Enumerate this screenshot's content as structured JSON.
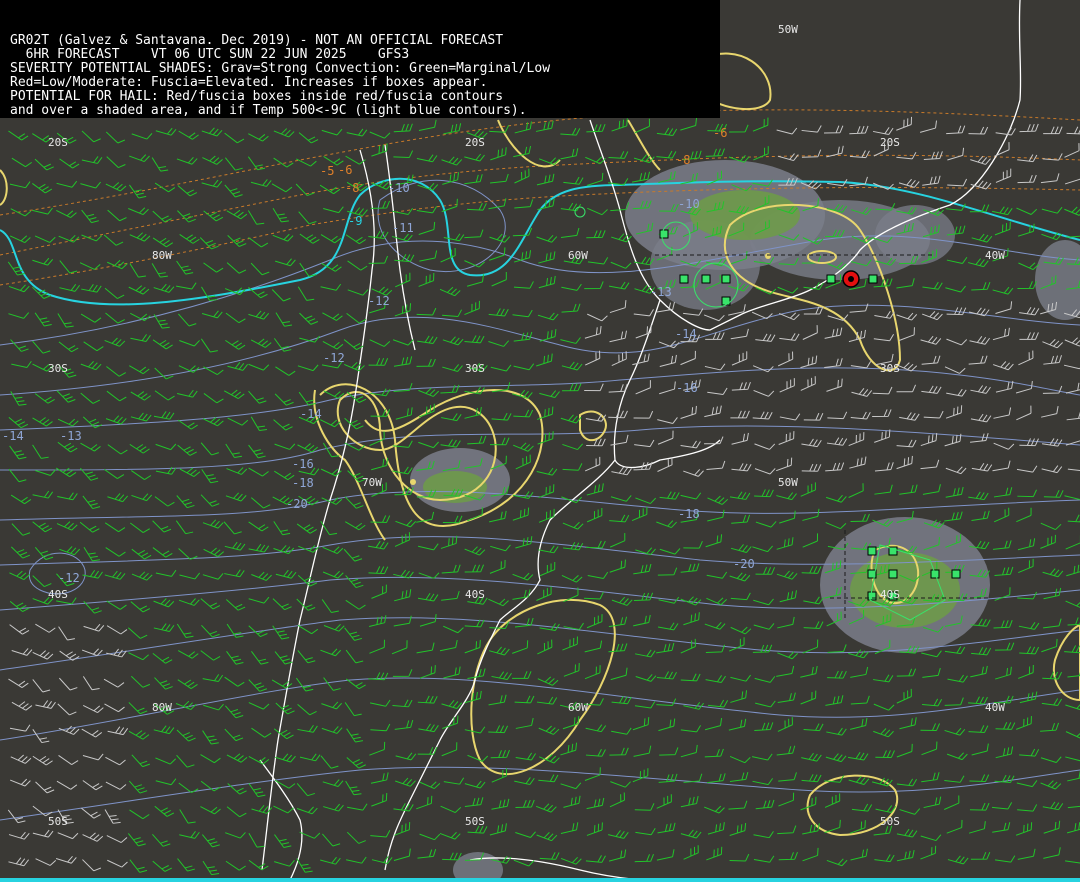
{
  "header": {
    "line1": "GR02T (Galvez & Santavana. Dec 2019) - NOT AN OFFICIAL FORECAST",
    "line2": "  6HR FORECAST    VT 06 UTC SUN 22 JUN 2025    GFS3",
    "line3": "SEVERITY POTENTIAL SHADES: Grav=Strong Convection: Green=Marginal/Low",
    "line4": "Red=Low/Moderate: Fuscia=Elevated. Increases if boxes appear.",
    "line5": "POTENTIAL FOR HAIL: Red/fuscia boxes inside red/fuscia contours",
    "line6": "and over a shaded area, and if Temp 500<-9C (light blue contours)."
  },
  "geo_labels": {
    "lat20_w": "20S",
    "lat20_m": "20S",
    "lat20_e": "20S",
    "lat30_w": "30S",
    "lat30_m": "30S",
    "lat30_e": "30S",
    "lat40_w": "40S",
    "lat40_m": "40S",
    "lat40_e": "40S",
    "lat50_w": "50S",
    "lat50_m": "50S",
    "lat50_e": "50S",
    "lon80_n": "80W",
    "lon60_n": "60W",
    "lon40_n": "40W",
    "lon50_top": "50W",
    "lon70_m": "70W",
    "lon50_m": "50W",
    "lon80_s": "80W",
    "lon60_s": "60W",
    "lon40_s": "40W"
  },
  "isotherm_labels": [
    "-10",
    "-11",
    "-12",
    "-13",
    "-14",
    "-16",
    "-18",
    "-20",
    "-12",
    "-13",
    "-14",
    "-16",
    "-18",
    "-20",
    "-12",
    "-10",
    "-14"
  ],
  "temp_labels": [
    "-5",
    "-6",
    "-8",
    "-8",
    "-6",
    "-6"
  ],
  "cyan_label": "-9",
  "colors": {
    "background": "#3a3935",
    "coast": "#ffffff",
    "isotherm": "#7f93c8",
    "temp500": "#c87a2a",
    "cyan": "#27d3e0",
    "yellow": "#e8d66e",
    "barb": "#22c42a",
    "barb_light": "#c8c8c8",
    "shade_gray": "#8a8d98",
    "shade_green": "#6fa24a",
    "box_green": "#39e36a",
    "hail_red": "#e31010"
  }
}
